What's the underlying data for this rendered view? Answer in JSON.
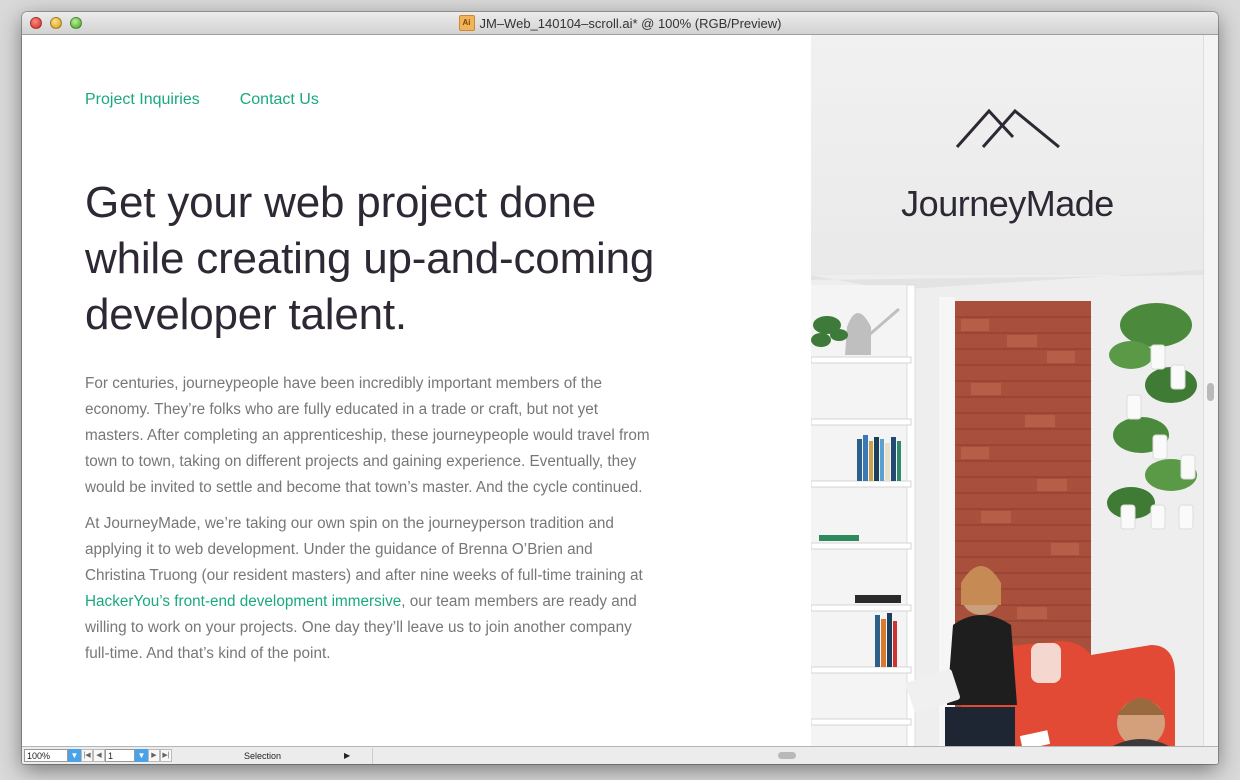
{
  "window": {
    "title": "JM–Web_140104–scroll.ai* @ 100% (RGB/Preview)",
    "doc_icon_label": "Ai"
  },
  "page": {
    "nav": [
      "Project Inquiries",
      "Contact Us"
    ],
    "headline_lines": [
      "Get your web project done",
      "while creating up-and-coming",
      "developer talent."
    ],
    "paragraph1": "For centuries, journeypeople have been incredibly important members of the economy. They’re folks who are fully educated in a trade or craft, but not yet masters. After completing an apprenticeship, these journeypeople would travel from town to town, taking on different projects and gaining experience. Eventually, they would be invited to settle and become that town’s master. And the cycle continued.",
    "paragraph2_before": "At JourneyMade, we’re taking our own spin on the journeyperson tradition and applying it to web development. Under the guidance of Brenna O’Brien and Christina Truong (our resident masters) and after nine weeks of full-time training at ",
    "paragraph2_link": "HackerYou’s front-end development immersive",
    "paragraph2_after": ", our team members are ready and willing to work on your projects. One day they’ll leave us to join another company full-time. And that’s kind of the point.",
    "logo_text": "JourneyMade"
  },
  "statusbar": {
    "zoom": "100%",
    "page": "1",
    "tool": "Selection"
  },
  "colors": {
    "accent": "#1aa87e",
    "heading": "#2d2833",
    "body_text": "#777777"
  }
}
